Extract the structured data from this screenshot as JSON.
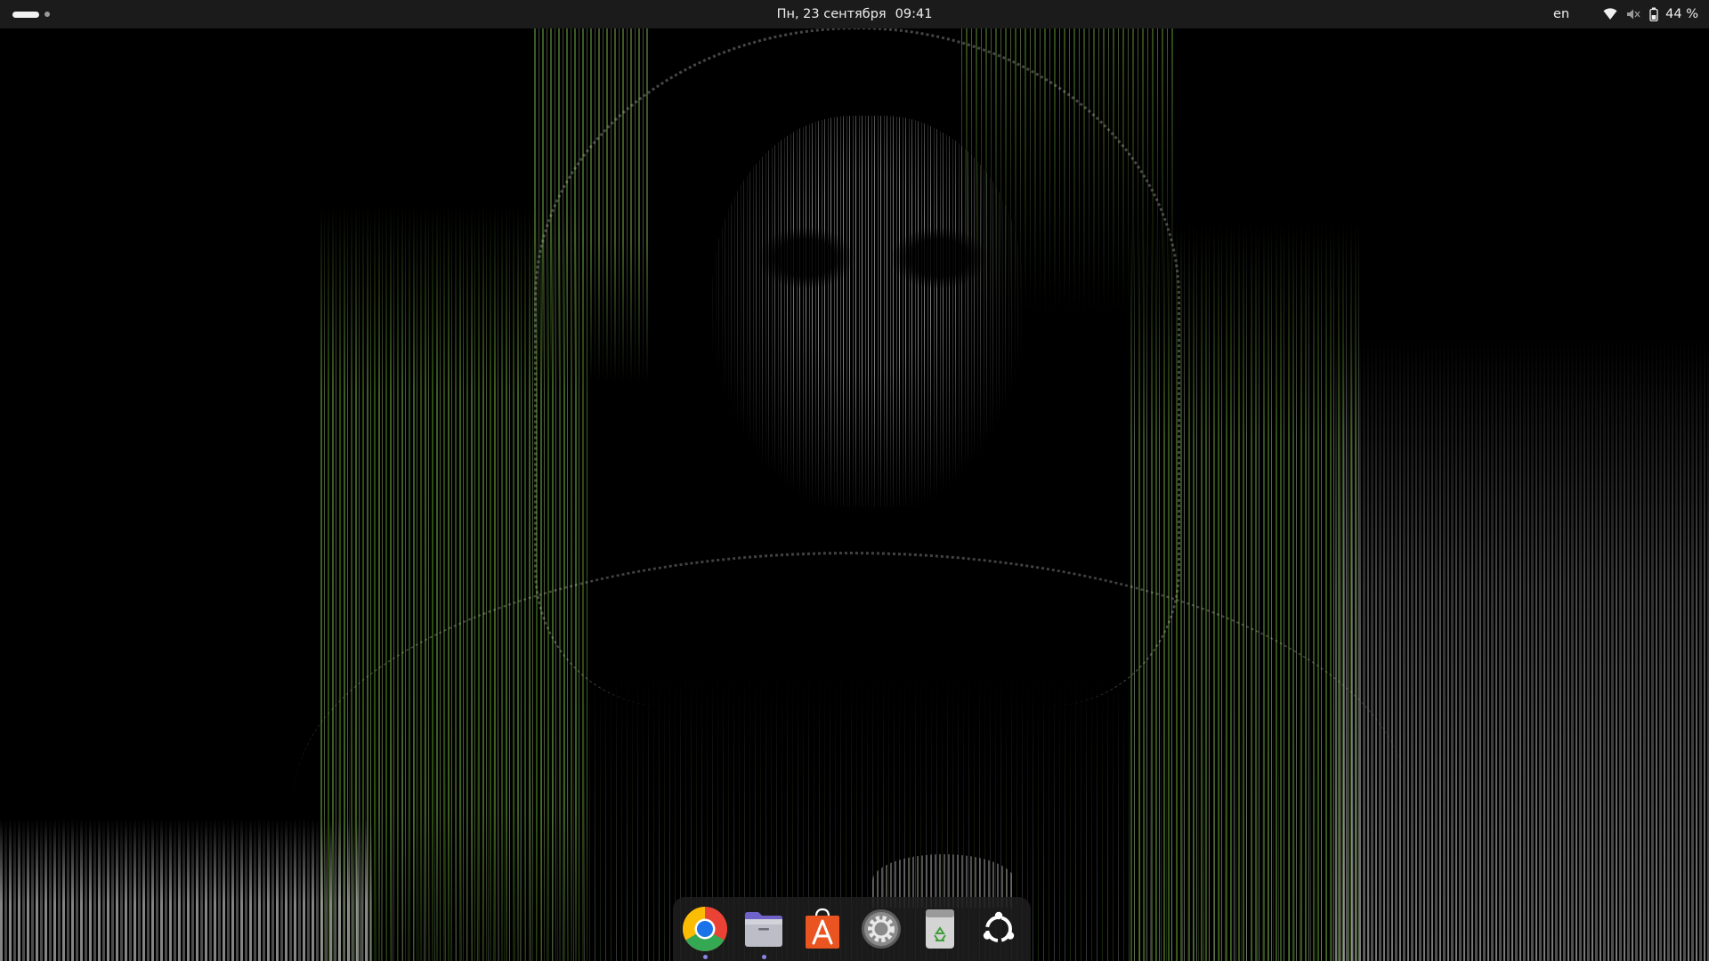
{
  "top_bar": {
    "date": "Пн, 23 сентября",
    "time": "09:41",
    "input_language": "en",
    "battery_percent": "44 %"
  },
  "status_icons": [
    "wifi-icon",
    "volume-muted-icon",
    "battery-icon"
  ],
  "dock": {
    "apps": [
      {
        "name": "Google Chrome",
        "icon": "chrome-icon",
        "running": true
      },
      {
        "name": "Files",
        "icon": "files-folder-icon",
        "running": true
      },
      {
        "name": "App Center",
        "icon": "app-center-icon",
        "running": false
      },
      {
        "name": "Settings",
        "icon": "settings-gear-icon",
        "running": false
      },
      {
        "name": "Trash",
        "icon": "trash-icon",
        "running": false
      },
      {
        "name": "Show Apps",
        "icon": "ubuntu-apps-icon",
        "running": false
      }
    ]
  },
  "colors": {
    "top_bar_bg": "#1b1b1b",
    "running_indicator": "#8a86e8",
    "wallpaper_accent": "#6ea83c"
  }
}
